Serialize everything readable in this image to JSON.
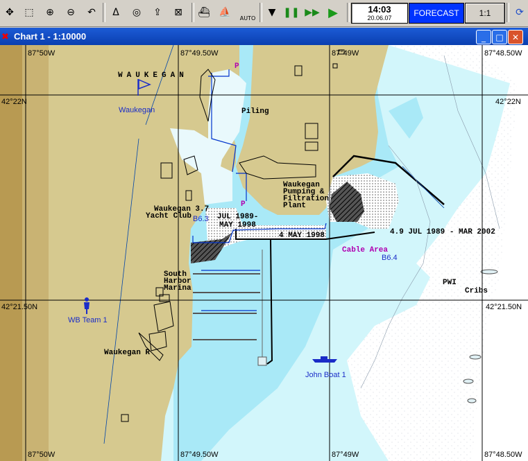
{
  "toolbar": {
    "buttons": [
      {
        "name": "move-icon",
        "glyph": "✥"
      },
      {
        "name": "zoom-box-icon",
        "glyph": "⬚"
      },
      {
        "name": "zoom-in-icon",
        "glyph": "⊕"
      },
      {
        "name": "zoom-out-icon",
        "glyph": "⊖"
      },
      {
        "name": "undo-icon",
        "glyph": "↶"
      },
      {
        "name": "compass-icon",
        "glyph": "Δ"
      },
      {
        "name": "target-icon",
        "glyph": "◎"
      },
      {
        "name": "export-icon",
        "glyph": "⇪"
      },
      {
        "name": "clear-icon",
        "glyph": "⊠"
      },
      {
        "name": "boat-icon",
        "glyph": "⛴"
      },
      {
        "name": "ship-icon",
        "glyph": "⛵"
      },
      {
        "name": "stop-icon",
        "glyph": "▼"
      },
      {
        "name": "pause-icon",
        "glyph": "❚❚"
      },
      {
        "name": "fast-forward-icon",
        "glyph": "▶▶"
      },
      {
        "name": "play-icon",
        "glyph": "▶"
      },
      {
        "name": "refresh-icon",
        "glyph": "⟳"
      }
    ],
    "auto_label": "AUTO",
    "time": "14:03",
    "date": "20.06.07",
    "forecast_label": "FORECAST",
    "scale_label": "1:1"
  },
  "window": {
    "title": "Chart 1 - 1:10000",
    "minimize": "_",
    "maximize": "□",
    "close": "✕"
  },
  "chart": {
    "lon_labels": [
      "87°50W",
      "87°49.50W",
      "87°49W",
      "87°48.50W"
    ],
    "lat_labels": [
      "42°22N",
      "42°21.50N"
    ],
    "features": {
      "waukegan": "WAUKEGAN",
      "piling": "Piling",
      "pumping1": "Waukegan",
      "pumping2": "Pumping &",
      "pumping3": "Filtration",
      "pumping4": "Plant",
      "yacht1": "Waukegan 3.7",
      "yacht2": "Yacht Club",
      "date1": "JUL 1989-",
      "date2": "MAY 1998",
      "may": "4  MAY 1998",
      "jul": "4.9  JUL 1989 - MAR 2002",
      "south1": "South",
      "south2": "Harbor",
      "south3": "Marina",
      "pwi": "PWI",
      "cribs": "Cribs",
      "waukegan_r": "Waukegan R",
      "p1": "P",
      "p2": "P"
    },
    "blue_labels": {
      "waukegan_flag": "Waukegan",
      "b63": "B6.3",
      "b64": "B6.4",
      "wb_team": "WB Team 1",
      "john_boat": "John Boat 1"
    },
    "cable_area": "Cable Area",
    "colors": {
      "land": "#d6c98f",
      "shallow": "#a9e9f7",
      "water": "#d2f6fb",
      "deep": "#ffffff",
      "grid": "#000000",
      "title_bar": "#0a46c8",
      "forecast": "#0033ff"
    }
  }
}
